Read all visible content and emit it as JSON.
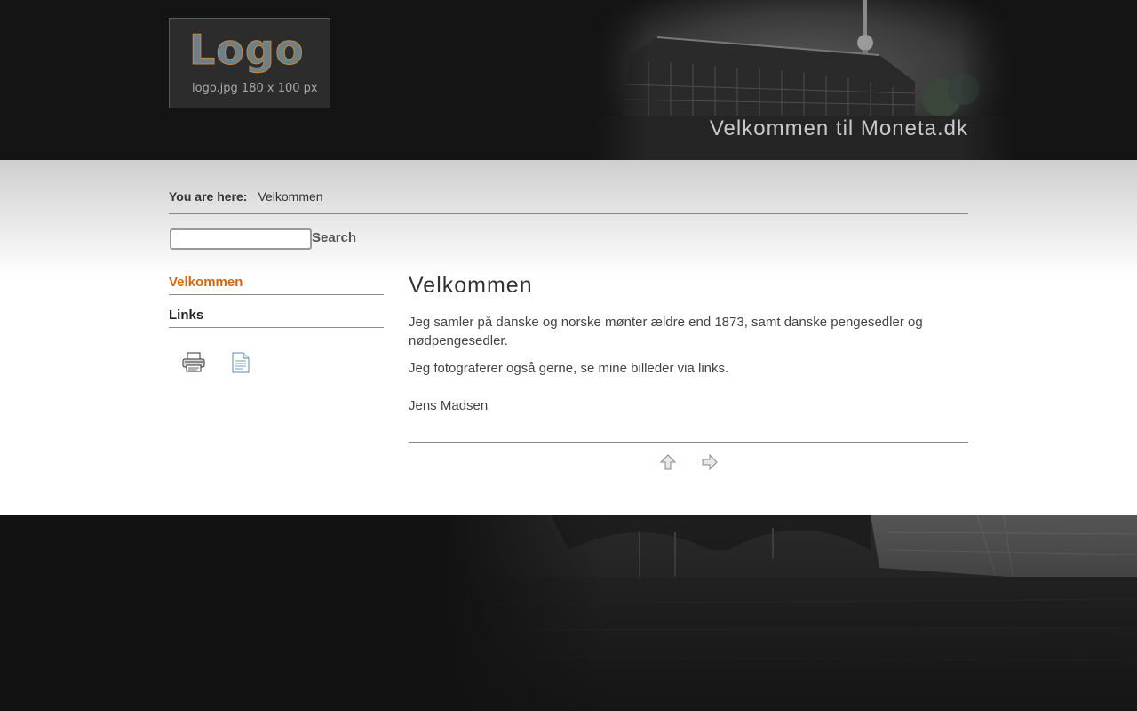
{
  "header": {
    "logo": {
      "text": "Logo",
      "caption": "logo.jpg 180 x 100 px"
    },
    "site_title": "Velkommen til Moneta.dk"
  },
  "breadcrumb": {
    "label": "You are here:",
    "current": "Velkommen"
  },
  "search": {
    "value": "",
    "placeholder": "",
    "button_label": "Search"
  },
  "sidebar": {
    "menu": [
      {
        "label": "Velkommen",
        "active": true
      },
      {
        "label": "Links",
        "active": false
      }
    ],
    "icons": [
      "print-icon",
      "document-icon"
    ]
  },
  "article": {
    "title": "Velkommen",
    "paragraphs": [
      "Jeg samler på danske og norske mønter ældre end 1873, samt danske pengesedler og nødpengesedler.",
      "Jeg fotograferer også gerne, se mine billeder via links."
    ],
    "signature": "Jens Madsen"
  },
  "pagination": {
    "icons": [
      "up-arrow-icon",
      "next-arrow-icon"
    ]
  },
  "colors": {
    "accent": "#c96a12",
    "header_bg": "#141414",
    "footer_bg": "#121212",
    "text": "#444444"
  }
}
